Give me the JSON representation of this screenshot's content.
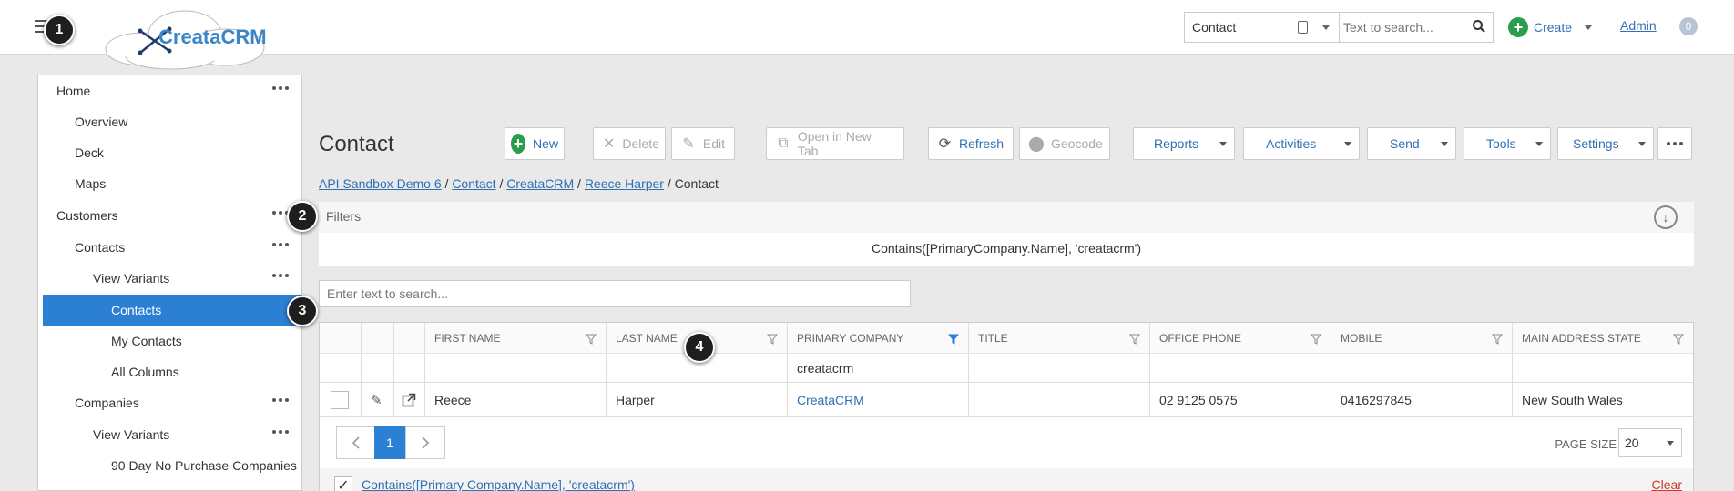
{
  "app": {
    "logo_text": "CreataCRM"
  },
  "badges": {
    "b1": "1",
    "b2": "2",
    "b3": "3",
    "b4": "4"
  },
  "header": {
    "entity_select": "Contact",
    "search_placeholder": "Text to search...",
    "create_label": "Create",
    "admin_label": "Admin",
    "user_initial": "0"
  },
  "sidebar": {
    "items": [
      {
        "label": "Home"
      },
      {
        "label": "Overview"
      },
      {
        "label": "Deck"
      },
      {
        "label": "Maps"
      },
      {
        "label": "Customers"
      },
      {
        "label": "Contacts"
      },
      {
        "label": "View Variants"
      },
      {
        "label": "Contacts"
      },
      {
        "label": "My Contacts"
      },
      {
        "label": "All Columns"
      },
      {
        "label": "Companies"
      },
      {
        "label": "View Variants"
      },
      {
        "label": "90 Day No Purchase Companies"
      }
    ]
  },
  "main": {
    "title": "Contact",
    "toolbar": {
      "new": "New",
      "delete": "Delete",
      "edit": "Edit",
      "open_new_tab": "Open in New Tab",
      "refresh": "Refresh",
      "geocode": "Geocode",
      "reports": "Reports",
      "activities": "Activities",
      "send": "Send",
      "tools": "Tools",
      "settings": "Settings"
    },
    "breadcrumb": {
      "items": [
        "API Sandbox Demo 6",
        "Contact",
        "CreataCRM",
        "Reece Harper"
      ],
      "current": "Contact",
      "sep": "/"
    },
    "filters": {
      "label": "Filters",
      "expression": "Contains([PrimaryCompany.Name], 'creatacrm')"
    },
    "grid_search_placeholder": "Enter text to search...",
    "grid": {
      "columns": [
        "FIRST NAME",
        "LAST NAME",
        "PRIMARY COMPANY",
        "TITLE",
        "OFFICE PHONE",
        "MOBILE",
        "MAIN ADDRESS STATE"
      ],
      "filter_values": {
        "primary_company": "creatacrm"
      },
      "rows": [
        {
          "first_name": "Reece",
          "last_name": "Harper",
          "primary_company": "CreataCRM",
          "title": "",
          "office_phone": "02 9125 0575",
          "mobile": "0416297845",
          "state": "New South Wales"
        }
      ],
      "pager": {
        "current_page": "1",
        "page_size_label": "PAGE SIZE",
        "page_size": "20"
      },
      "applied_filter": "Contains([Primary Company.Name], 'creatacrm')",
      "clear_label": "Clear"
    }
  },
  "colors": {
    "accent": "#2b80d4",
    "link": "#2f6fb3",
    "green": "#2a9d4e",
    "danger": "#d0362b"
  }
}
